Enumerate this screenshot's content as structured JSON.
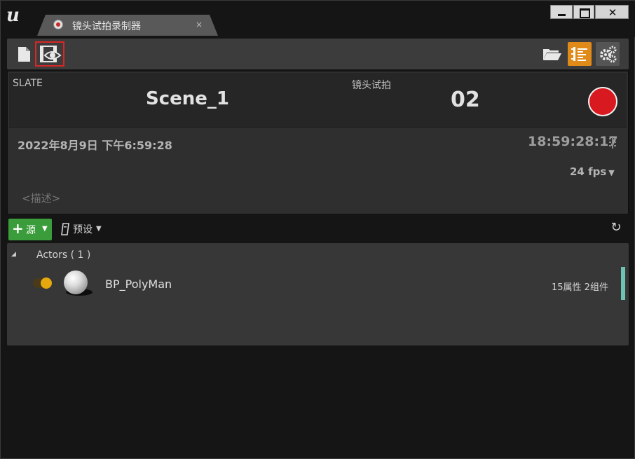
{
  "colors": {
    "record_red": "#d8191f",
    "layout_button_orange": "#e08b19",
    "add_source_green": "#3b9c3b",
    "toggle_on": "#e5a90f",
    "row_accent": "#6fc2b3"
  },
  "window": {
    "tab_title": "镜头试拍录制器",
    "tab_close": "×",
    "logo_icon": "unreal-logo"
  },
  "toolbar": {
    "icons": [
      "new-document-icon",
      "review-takes-icon",
      "open-folder-icon",
      "layout-icon",
      "settings-icon"
    ]
  },
  "slate": {
    "slate_label": "SLATE",
    "scene_name": "Scene_1",
    "take_label": "镜头试拍",
    "take_number": "02",
    "date": "2022年8月9日 下午6:59:28",
    "timecode": "18:59:28:17",
    "frame_rate": "24 fps",
    "description_placeholder": "<描述>"
  },
  "sources": {
    "add_label": "源",
    "presets_label": "预设",
    "group_label": "Actors ( 1 )",
    "rows": [
      {
        "name": "BP_PolyMan",
        "info": "15属性 2组件",
        "enabled": true
      }
    ]
  }
}
